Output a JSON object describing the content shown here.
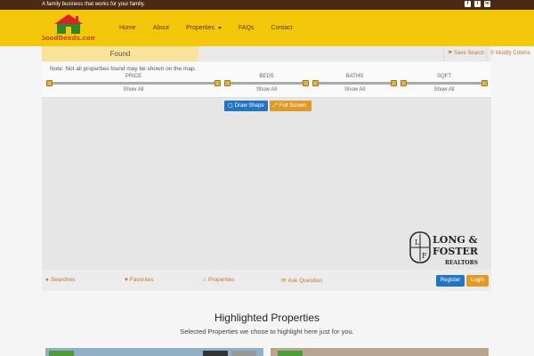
{
  "topbar": {
    "tagline": "A family business that works for your family.",
    "social": [
      "f",
      "t",
      "in"
    ]
  },
  "brand": {
    "logo_text": "GoodDeeds.com"
  },
  "nav": {
    "items": [
      {
        "label": "Home"
      },
      {
        "label": "About"
      },
      {
        "label": "Properties"
      },
      {
        "label": "FAQs"
      },
      {
        "label": "Contact"
      }
    ]
  },
  "search": {
    "found_label": "Found",
    "save_search": "Save Search",
    "modify_criteria": "Modify Criteria",
    "note": "Note: Not all properties found may be shown on the map.",
    "filters": [
      {
        "label": "PRICE",
        "value": "Show All"
      },
      {
        "label": "BEDS",
        "value": "Show All"
      },
      {
        "label": "BATHS",
        "value": "Show All"
      },
      {
        "label": "SQFT",
        "value": "Show All"
      }
    ]
  },
  "map": {
    "draw_shape": "Draw Shape",
    "full_screen": "Full Screen",
    "watermark": {
      "line1": "LONG &",
      "line2": "FOSTER",
      "line3": "REALTORS",
      "initials": "L F"
    }
  },
  "actions": {
    "searches": "Searches",
    "favorites": "Favorites",
    "properties": "Properties",
    "ask_question": "Ask Question",
    "register": "Register",
    "login": "Login"
  },
  "highlighted": {
    "title": "Highlighted Properties",
    "subtitle": "Selected Properties we chose to highlight here just for you."
  },
  "colors": {
    "brand_yellow": "#f4c80a",
    "topbar_brown": "#4a2a14",
    "accent_blue": "#2275c2",
    "accent_orange": "#e39a25"
  }
}
